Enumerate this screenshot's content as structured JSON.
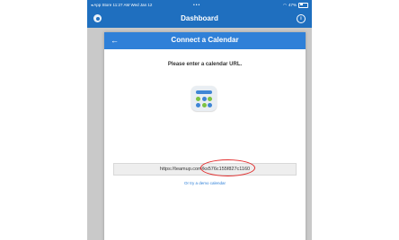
{
  "status_bar": {
    "left_text": "◂ App Store  11:27 AM  Wed Jan 12",
    "dots": "•••",
    "battery_text": "47%"
  },
  "app_bar": {
    "title": "Dashboard",
    "left_icon": "settings-icon",
    "right_icon": "info-icon",
    "right_glyph": "i"
  },
  "modal": {
    "title": "Connect a Calendar",
    "back_glyph": "←",
    "prompt": "Please enter a calendar URL.",
    "app_icon": "calendar-app-icon",
    "url_value": "https://teamup.com/ks576c155f827c1160",
    "demo_link": "Or try a demo calendar"
  },
  "colors": {
    "app_bar": "#1f6fbf",
    "modal_header": "#2f80d8",
    "highlight": "#e22a2a"
  }
}
